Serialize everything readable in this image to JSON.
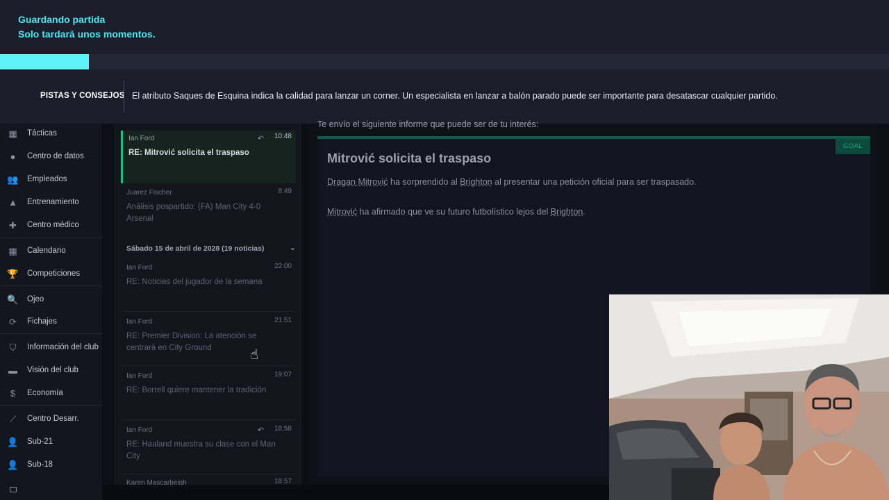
{
  "save_banner": {
    "title": "Guardando partida",
    "subtitle": "Solo tardará unos momentos.",
    "progress": 0.1
  },
  "tips": {
    "title": "PISTAS Y CONSEJOS",
    "text": "El atributo Saques de Esquina indica la calidad para lanzar un corner. Un especialista en lanzar a balón parado puede ser importante para desatascar cualquier partido."
  },
  "sidebar": {
    "items": [
      {
        "label": "Tácticas",
        "icon": "tactics-icon"
      },
      {
        "label": "Centro de datos",
        "icon": "data-centre-icon"
      },
      {
        "label": "Empleados",
        "icon": "staff-icon"
      },
      {
        "label": "Entrenamiento",
        "icon": "training-icon"
      },
      {
        "label": "Centro médico",
        "icon": "medical-icon"
      },
      {
        "label": "Calendario",
        "icon": "calendar-icon"
      },
      {
        "label": "Competiciones",
        "icon": "trophy-icon"
      },
      {
        "label": "Ojeo",
        "icon": "search-icon"
      },
      {
        "label": "Fichajes",
        "icon": "transfers-icon"
      },
      {
        "label": "Información del club",
        "icon": "shield-icon"
      },
      {
        "label": "Visión del club",
        "icon": "briefcase-icon"
      },
      {
        "label": "Economía",
        "icon": "money-icon"
      },
      {
        "label": "Centro Desarr.",
        "icon": "development-icon"
      },
      {
        "label": "Sub-21",
        "icon": "u21-icon"
      },
      {
        "label": "Sub-18",
        "icon": "u18-icon"
      }
    ]
  },
  "inbox": {
    "messages_top": [
      {
        "sender": "Ian Ford",
        "time": "10:48",
        "subject": "RE: Mitrović solicita el traspaso",
        "active": true,
        "replied": true
      },
      {
        "sender": "Juarez Fischer",
        "time": "8:49",
        "subject": "Análisis pospartido: (FA) Man City 4-0 Arsenal",
        "active": false,
        "replied": false
      }
    ],
    "group_header": "Sábado 15 de abril de 2028 (19 noticias)",
    "messages_group": [
      {
        "sender": "Ian Ford",
        "time": "22:00",
        "subject": "RE: Noticias del jugador de la semana",
        "replied": false
      },
      {
        "sender": "Ian Ford",
        "time": "21:51",
        "subject": "RE: Premier Division: La atención se centrará en City Ground",
        "replied": false
      },
      {
        "sender": "Ian Ford",
        "time": "19:07",
        "subject": "RE: Borrell quiere mantener la tradición",
        "replied": false
      },
      {
        "sender": "Ian Ford",
        "time": "18:58",
        "subject": "RE: Haaland muestra su clase con el Man City",
        "replied": true
      },
      {
        "sender": "Karen Mascarbeigh",
        "time": "18:57",
        "subject": "",
        "replied": false
      }
    ]
  },
  "reader": {
    "intro": "Te envío el siguiente informe que puede ser de tu interés:",
    "badge": "GOAL",
    "title": "Mitrović solicita el traspaso",
    "p1_a": "Dragan Mitrović",
    "p1_b": " ha sorprendido al ",
    "p1_c": "Brighton",
    "p1_d": " al presentar una petición oficial para ser traspasado.",
    "p2_a": "Mitrović",
    "p2_b": " ha afirmado que ve su futuro futbolístico lejos del ",
    "p2_c": "Brighton",
    "p2_d": "."
  },
  "colors": {
    "accent_cyan": "#4ee6f0",
    "accent_green": "#1dbd8a"
  }
}
